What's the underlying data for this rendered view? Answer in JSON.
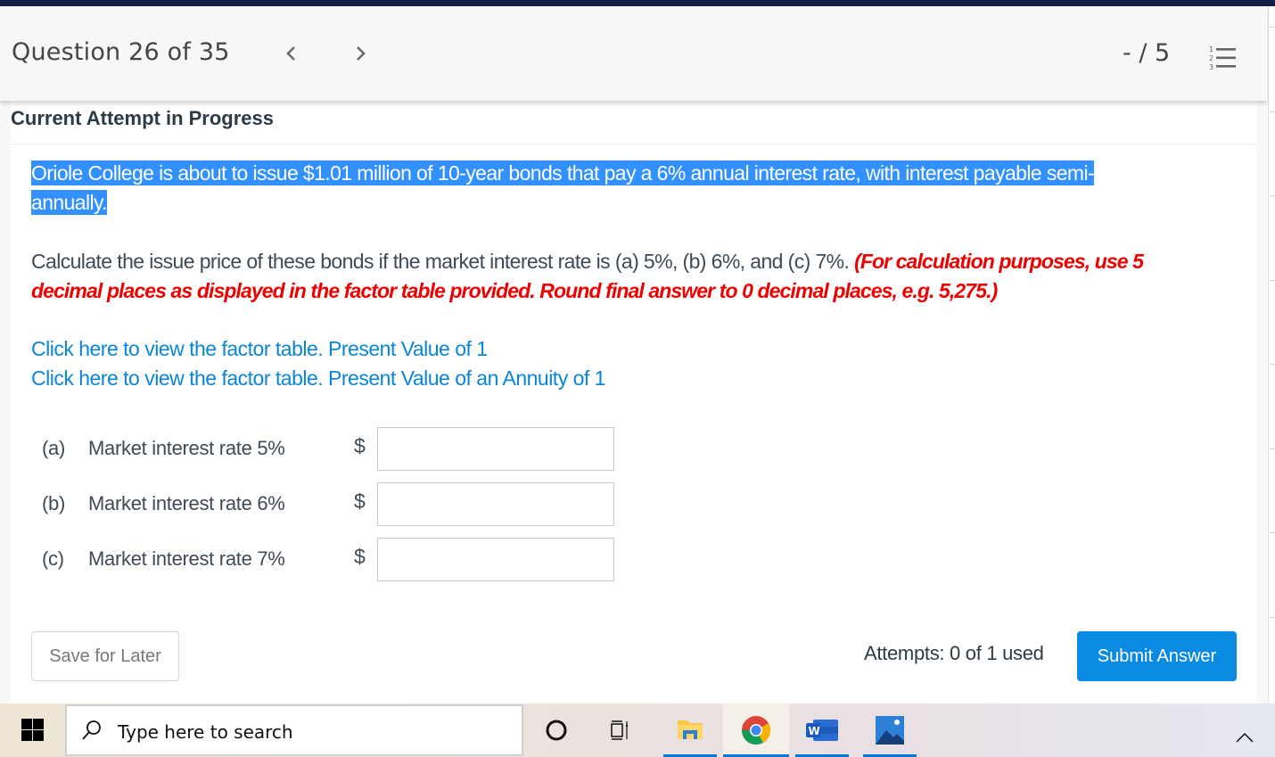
{
  "header": {
    "question_label": "Question 26 of 35",
    "prev_icon": "chevron-left-icon",
    "next_icon": "chevron-right-icon",
    "score": "- / 5",
    "question_list_icon": "numbered-list-icon"
  },
  "status": {
    "attempt_title": "Current Attempt in Progress"
  },
  "question": {
    "text_line1": "Oriole College is about to issue $1.01 million of 10-year bonds that pay a 6% annual interest rate, with interest payable semi-",
    "text_line2": "annually.",
    "instruction": "Calculate the issue price of these bonds if the market interest rate is (a) 5%, (b) 6%, and (c) 7%. ",
    "note": "(For calculation purposes, use 5 decimal places as displayed in the factor table provided. Round final answer to 0 decimal places, e.g. 5,275.)"
  },
  "links": [
    {
      "label": "Click here to view the factor table. Present Value of 1"
    },
    {
      "label": "Click here to view the factor table. Present Value of an Annuity of 1"
    }
  ],
  "answers": [
    {
      "letter": "(a)",
      "label": "Market interest rate 5%",
      "currency": "$",
      "value": ""
    },
    {
      "letter": "(b)",
      "label": "Market interest rate 6%",
      "currency": "$",
      "value": ""
    },
    {
      "letter": "(c)",
      "label": "Market interest rate 7%",
      "currency": "$",
      "value": ""
    }
  ],
  "footer": {
    "save_label": "Save for Later",
    "attempts_text": "Attempts: 0 of 1 used",
    "submit_label": "Submit Answer"
  },
  "colors": {
    "accent": "#0a8ae3",
    "link": "#0a85d8",
    "highlight": "#3390ff",
    "warning_text": "#ee0000",
    "top_strip": "#141e45"
  },
  "taskbar": {
    "start_icon": "windows-start-icon",
    "search_icon": "search-icon",
    "search_placeholder": "Type here to search",
    "apps": [
      {
        "name": "cortana-icon"
      },
      {
        "name": "task-view-icon"
      },
      {
        "name": "file-explorer-icon"
      },
      {
        "name": "chrome-icon"
      },
      {
        "name": "word-icon"
      },
      {
        "name": "photos-icon"
      }
    ],
    "tray_icon": "chevron-up-icon"
  }
}
